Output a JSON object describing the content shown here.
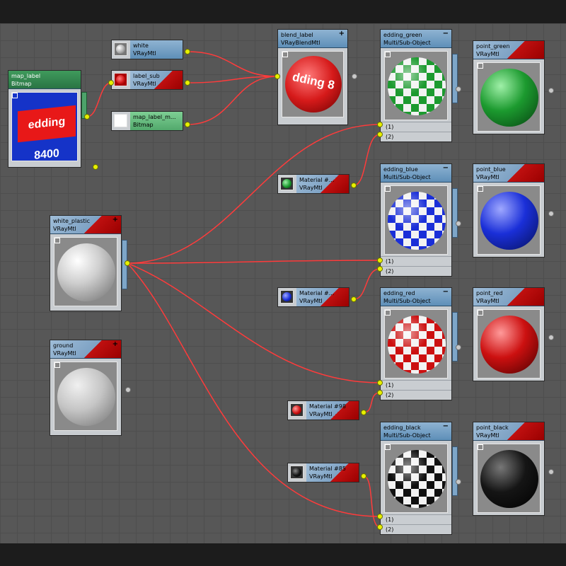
{
  "nodes": {
    "map_label": {
      "name": "map_label",
      "type": "Bitmap",
      "bitmap_text": "edding 8400"
    },
    "white": {
      "name": "white",
      "type": "VRayMtl"
    },
    "label_sub": {
      "name": "label_sub",
      "type": "VRayMtl"
    },
    "map_label_m": {
      "name": "map_label_m...",
      "type": "Bitmap"
    },
    "blend_label": {
      "name": "blend_label",
      "type": "VRayBlendMtl",
      "ball_text": "dding 8"
    },
    "edding_green": {
      "name": "edding_green",
      "type": "Multi/Sub-Object",
      "slot1": "(1)",
      "slot2": "(2)"
    },
    "edding_blue": {
      "name": "edding_blue",
      "type": "Multi/Sub-Object",
      "slot1": "(1)",
      "slot2": "(2)"
    },
    "edding_red": {
      "name": "edding_red",
      "type": "Multi/Sub-Object",
      "slot1": "(1)",
      "slot2": "(2)"
    },
    "edding_black": {
      "name": "edding_black",
      "type": "Multi/Sub-Object",
      "slot1": "(1)",
      "slot2": "(2)"
    },
    "point_green": {
      "name": "point_green",
      "type": "VRayMtl"
    },
    "point_blue": {
      "name": "point_blue",
      "type": "VRayMtl"
    },
    "point_red": {
      "name": "point_red",
      "type": "VRayMtl"
    },
    "point_black": {
      "name": "point_black",
      "type": "VRayMtl"
    },
    "material_a": {
      "name": "Material #...",
      "type": "VRayMtl"
    },
    "material_b": {
      "name": "Material #...",
      "type": "VRayMtl"
    },
    "material_98": {
      "name": "Material #98",
      "type": "VRayMtl"
    },
    "material_85": {
      "name": "Material #85",
      "type": "VRayMtl"
    },
    "white_plastic": {
      "name": "white_plastic",
      "type": "VRayMtl"
    },
    "ground": {
      "name": "ground",
      "type": "VRayMtl"
    }
  },
  "colors": {
    "wire": "#ff3b3b",
    "port": "#e7f000",
    "green": "#1c9a2f",
    "blue": "#1a2fd8",
    "red": "#cc1010",
    "black": "#101010"
  }
}
